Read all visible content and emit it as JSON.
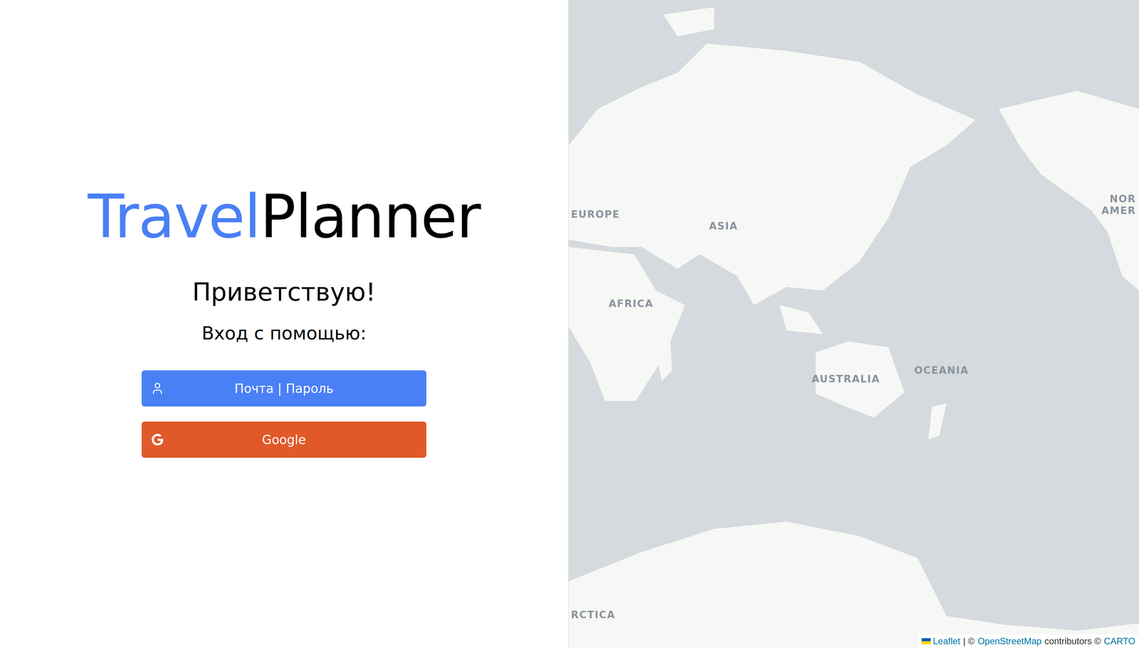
{
  "brand": {
    "first": "Travel",
    "second": "Planner"
  },
  "greeting": "Приветствую!",
  "prompt": "Вход с помощью:",
  "buttons": [
    {
      "label": "Почта | Пароль",
      "kind": "email",
      "color": "#4a80f5"
    },
    {
      "label": "Google",
      "kind": "google",
      "color": "#e15829"
    }
  ],
  "map": {
    "labels": [
      {
        "lines": [
          "EUROPE"
        ]
      },
      {
        "lines": [
          "ASIA"
        ]
      },
      {
        "lines": [
          "AFRICA"
        ]
      },
      {
        "lines": [
          "AUSTRALIA"
        ]
      },
      {
        "lines": [
          "OCEANIA"
        ]
      },
      {
        "lines": [
          "NOR",
          "AMER"
        ]
      },
      {
        "lines": [
          "RCTICA"
        ]
      }
    ],
    "attribution": [
      {
        "text": "Leaflet",
        "link": true
      },
      {
        "text": "| ©",
        "link": false
      },
      {
        "text": "OpenStreetMap",
        "link": true
      },
      {
        "text": "contributors ©",
        "link": false
      },
      {
        "text": "CARTO",
        "link": true
      }
    ]
  }
}
